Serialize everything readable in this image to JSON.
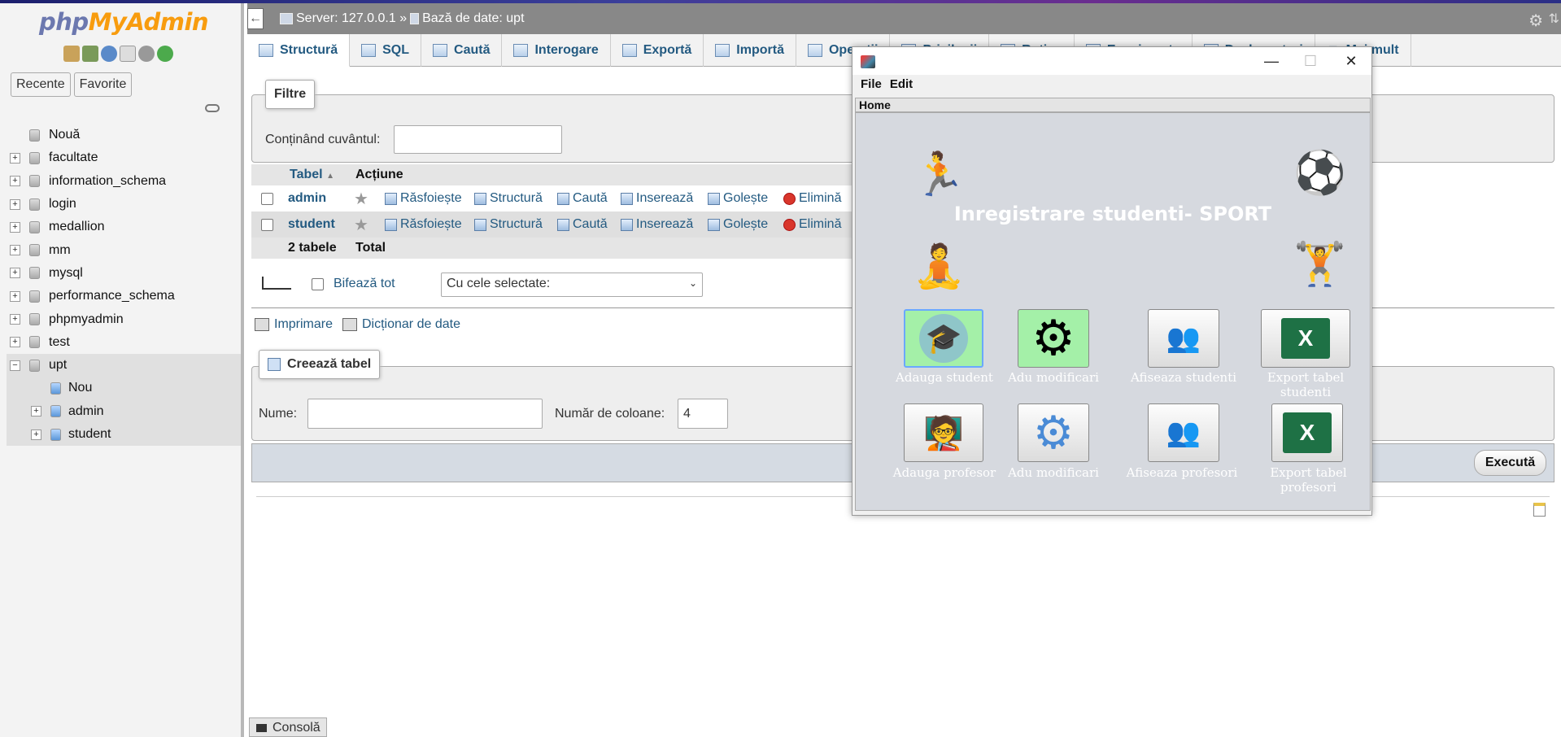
{
  "nav": {
    "logo_php": "php",
    "logo_ma": "MyAdmin",
    "tab_recent": "Recente",
    "tab_favorites": "Favorite",
    "tree": [
      {
        "label": "Nouă",
        "level": 0
      },
      {
        "label": "facultate",
        "level": 0
      },
      {
        "label": "information_schema",
        "level": 0
      },
      {
        "label": "login",
        "level": 0
      },
      {
        "label": "medallion",
        "level": 0
      },
      {
        "label": "mm",
        "level": 0
      },
      {
        "label": "mysql",
        "level": 0
      },
      {
        "label": "performance_schema",
        "level": 0
      },
      {
        "label": "phpmyadmin",
        "level": 0
      },
      {
        "label": "test",
        "level": 0
      },
      {
        "label": "upt",
        "level": 0
      },
      {
        "label": "Nou",
        "level": 1
      },
      {
        "label": "admin",
        "level": 1
      },
      {
        "label": "student",
        "level": 1
      }
    ]
  },
  "topbar": {
    "server": "Server: 127.0.0.1 »",
    "database": "Bază de date: upt"
  },
  "menu": {
    "tabs": [
      {
        "label": "Structură"
      },
      {
        "label": "SQL"
      },
      {
        "label": "Caută"
      },
      {
        "label": "Interogare"
      },
      {
        "label": "Exportă"
      },
      {
        "label": "Importă"
      },
      {
        "label": "Operații"
      },
      {
        "label": "Privilegii"
      },
      {
        "label": "Rutine"
      },
      {
        "label": "Evenimente"
      },
      {
        "label": "Declanșatori"
      },
      {
        "label": "Mai mult"
      }
    ]
  },
  "filters": {
    "legend": "Filtre",
    "label": "Conținând cuvântul:",
    "value": ""
  },
  "table": {
    "headers": [
      "Tabel",
      "Acțiune"
    ],
    "rows": [
      {
        "name": "admin"
      },
      {
        "name": "student"
      }
    ],
    "actions": [
      "Răsfoiește",
      "Structură",
      "Caută",
      "Inserează",
      "Golește",
      "Elimină"
    ],
    "footer_count": "2 tabele",
    "footer_total": "Total"
  },
  "bulk": {
    "check_all": "Bifează tot",
    "with_selected": "Cu cele selectate:"
  },
  "links": {
    "print": "Imprimare",
    "dictionary": "Dicționar de date"
  },
  "create": {
    "legend": "Creează tabel",
    "name_label": "Nume:",
    "name_value": "",
    "cols_label": "Număr de coloane:",
    "cols_value": "4",
    "execute": "Execută"
  },
  "console": "Consolă",
  "app": {
    "menu_file": "File",
    "menu_edit": "Edit",
    "tab_home": "Home",
    "heading": "Inregistrare studenti- SPORT",
    "buttons": [
      {
        "label": "Adauga student",
        "icon": "student-avatar-icon"
      },
      {
        "label": "Adu modificari",
        "icon": "gear-icon"
      },
      {
        "label": "Afiseaza studenti",
        "icon": "people-icon"
      },
      {
        "label": "Export tabel studenti",
        "icon": "excel-icon"
      },
      {
        "label": "Adauga profesor",
        "icon": "teacher-icon"
      },
      {
        "label": "Adu modificari",
        "icon": "gear-outline-icon"
      },
      {
        "label": "Afiseaza profesori",
        "icon": "professors-icon"
      },
      {
        "label": "Export tabel profesori",
        "icon": "excel-icon"
      }
    ]
  }
}
